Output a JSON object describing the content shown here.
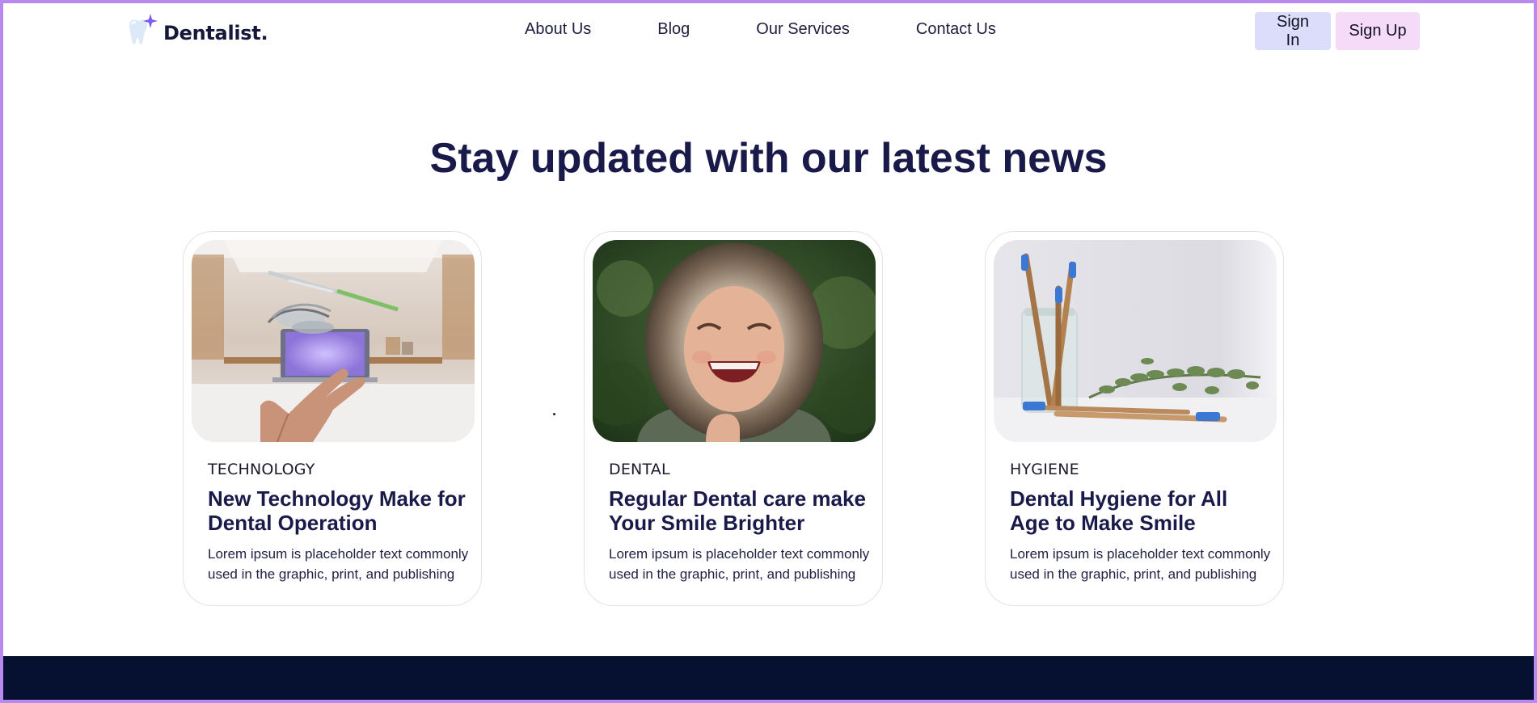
{
  "brand": {
    "name": "Dentalist."
  },
  "nav": {
    "links": [
      {
        "label": "About Us"
      },
      {
        "label": "Blog"
      },
      {
        "label": "Our Services"
      },
      {
        "label": "Contact Us"
      }
    ]
  },
  "auth": {
    "sign_in": "Sign In",
    "sign_up": "Sign Up"
  },
  "news": {
    "heading": "Stay updated with our latest news",
    "cards": [
      {
        "category": "TECHNOLOGY",
        "title": "New Technology Make for Dental Operation",
        "excerpt": "Lorem ipsum is placeholder text commonly used in the graphic, print, and publishing"
      },
      {
        "category": "DENTAL",
        "title": "Regular Dental care make Your Smile Brighter",
        "excerpt": "Lorem ipsum is placeholder text commonly used in the graphic, print, and publishing"
      },
      {
        "category": "HYGIENE",
        "title": "Dental Hygiene for All Age to Make Smile",
        "excerpt": "Lorem ipsum is placeholder text commonly used in the graphic, print, and publishing"
      }
    ]
  },
  "colors": {
    "heading": "#1a1a4a",
    "sign_in_bg": "#dcdcfb",
    "sign_up_bg": "#f5dbf7",
    "footer": "#061030",
    "frame": "#b88af0"
  },
  "icons": {
    "logo": "tooth-sparkle-icon"
  }
}
